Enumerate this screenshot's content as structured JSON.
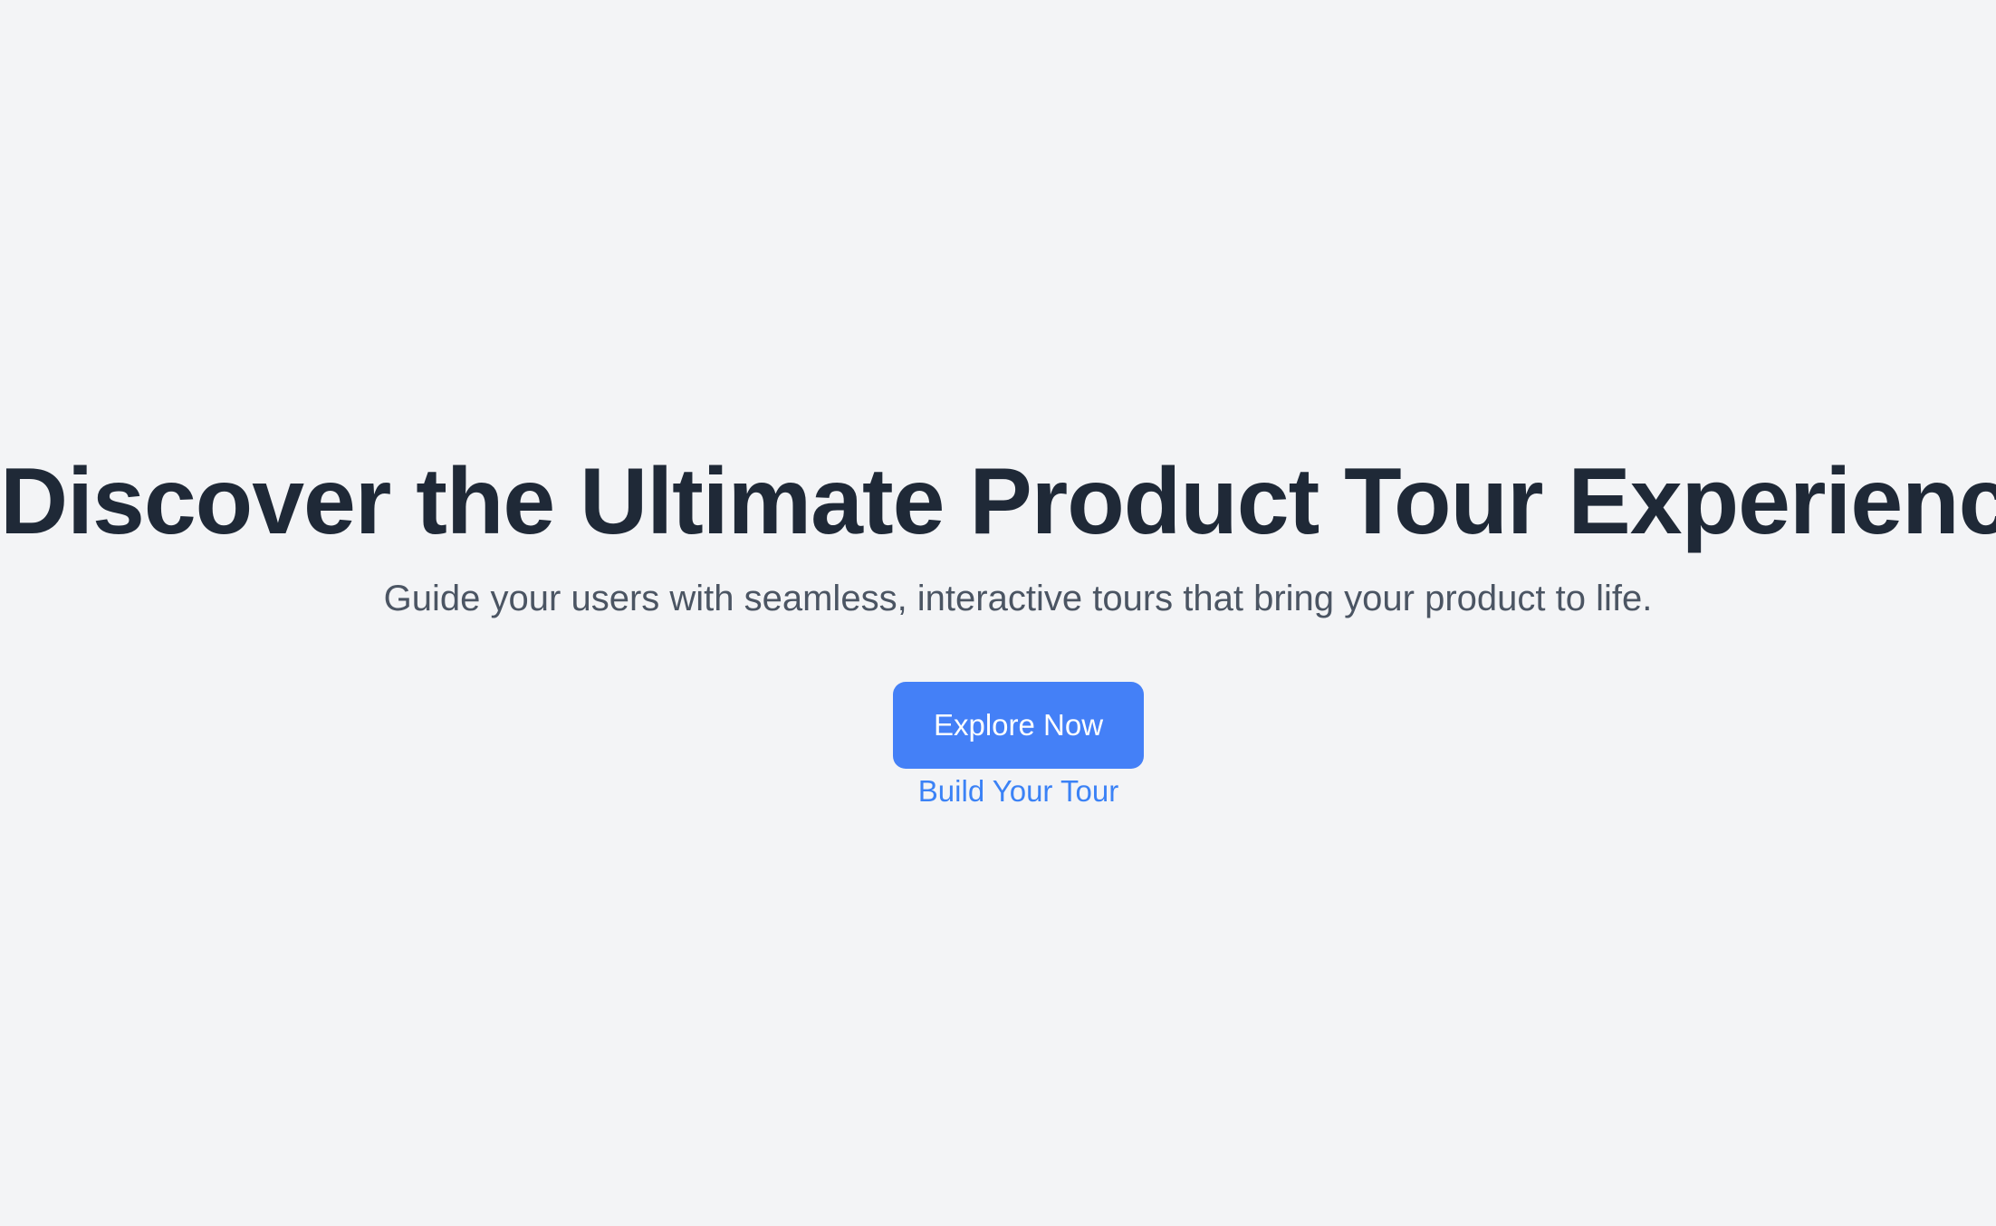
{
  "hero": {
    "headline": "Discover the Ultimate Product Tour Experience",
    "subheadline": "Guide your users with seamless, interactive tours that bring your product to life.",
    "primary_cta": "Explore Now",
    "secondary_cta": "Build Your Tour"
  },
  "colors": {
    "background": "#F3F4F6",
    "headline": "#1F2937",
    "subheadline": "#4B5563",
    "accent": "#3B82F6",
    "button_text": "#FFFFFF"
  }
}
